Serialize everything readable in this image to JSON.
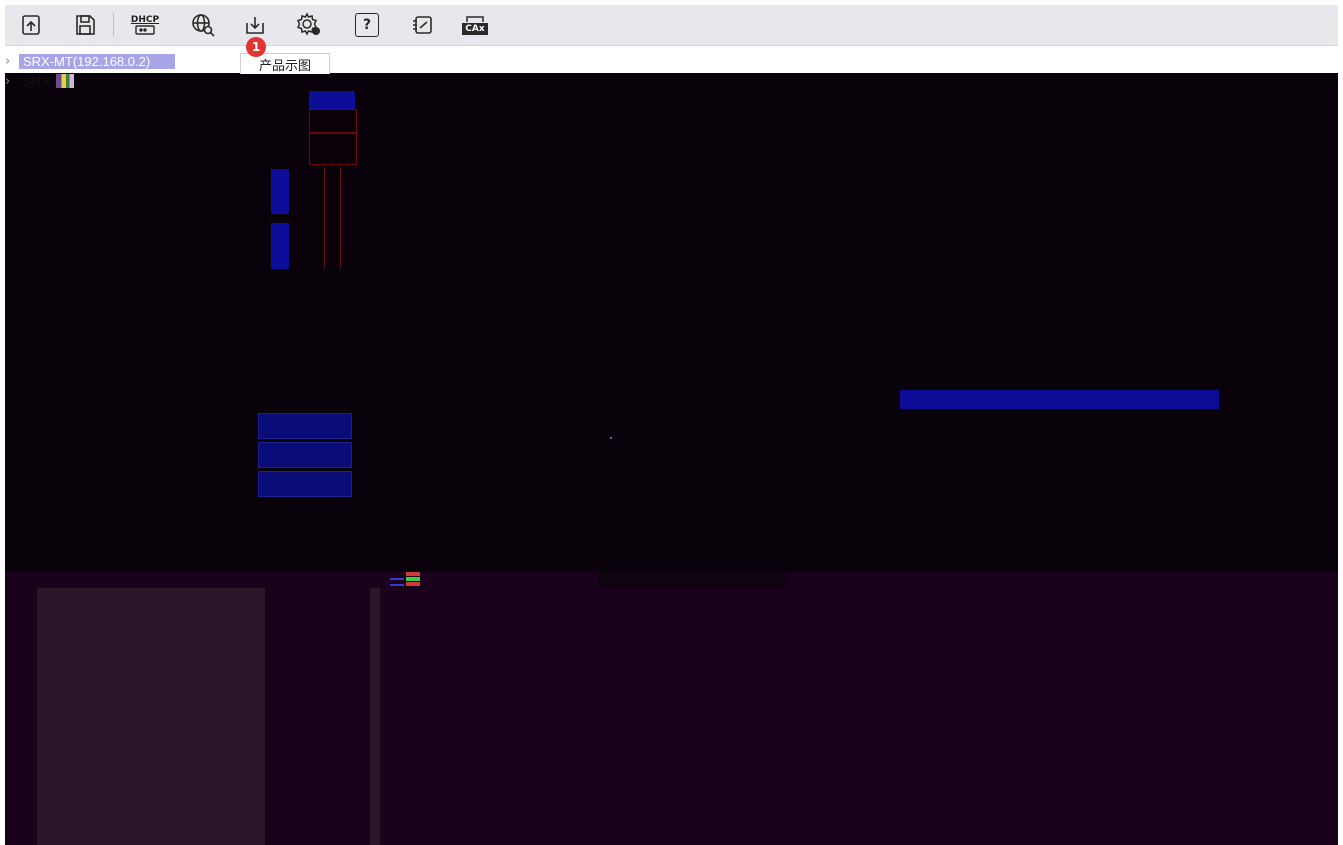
{
  "toolbar": {
    "buttons": [
      {
        "id": "import",
        "icon": "import-icon"
      },
      {
        "id": "save",
        "icon": "save-icon"
      },
      {
        "id": "dhcp",
        "icon": "dhcp-icon",
        "label": "DHCP"
      },
      {
        "id": "network-search",
        "icon": "globe-search-icon"
      },
      {
        "id": "download",
        "icon": "download-icon"
      },
      {
        "id": "settings",
        "icon": "gear-icon"
      },
      {
        "id": "help",
        "icon": "help-icon",
        "label": "?"
      },
      {
        "id": "switch",
        "icon": "switch-icon"
      },
      {
        "id": "cax",
        "icon": "cax-icon",
        "label": "CAx"
      }
    ],
    "badge_count": "1"
  },
  "tree": {
    "items": [
      {
        "label": "SRX-MT(192.168.0.2)",
        "selected": true
      },
      {
        "label": "SRX",
        "selected": false
      }
    ]
  },
  "tabs": [
    {
      "label": "产品示图",
      "active": true
    }
  ],
  "colors": {
    "toolbar_bg": "#e8e8ec",
    "selection": "#a7a4e8",
    "canvas_bg": "#0a020a",
    "lower_bg": "#1a021c",
    "badge": "#e0362f",
    "accent_blue": "#0c0e9a",
    "wire_red": "#6a0a0a"
  }
}
